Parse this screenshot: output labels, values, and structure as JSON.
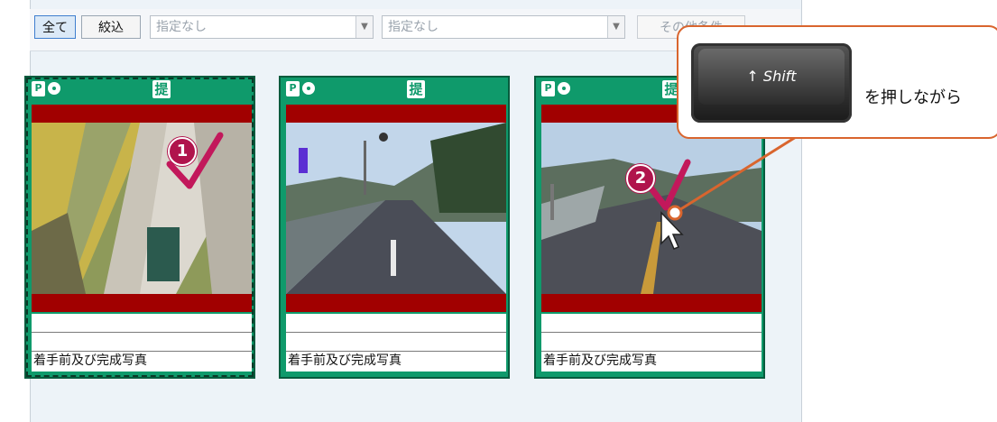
{
  "toolbar": {
    "all_label": "全て",
    "filter_label": "絞込",
    "combo1_value": "指定なし",
    "combo2_value": "指定なし",
    "other_conditions_label": "その他条件"
  },
  "cards": [
    {
      "caption": "着手前及び完成写真",
      "badge": "1"
    },
    {
      "caption": "着手前及び完成写真",
      "badge": ""
    },
    {
      "caption": "着手前及び完成写真",
      "badge": "2"
    }
  ],
  "callout": {
    "key_label": "Shift",
    "key_arrow": "↑",
    "text": "を押しながら"
  },
  "icons": {
    "pin": "photo-pin-icon",
    "disc": "disc-icon",
    "teishutsu_char": "提"
  },
  "colors": {
    "card_green": "#0f9a6b",
    "card_red": "#a10000",
    "badge": "#b0144c",
    "callout_border": "#d9652e"
  }
}
